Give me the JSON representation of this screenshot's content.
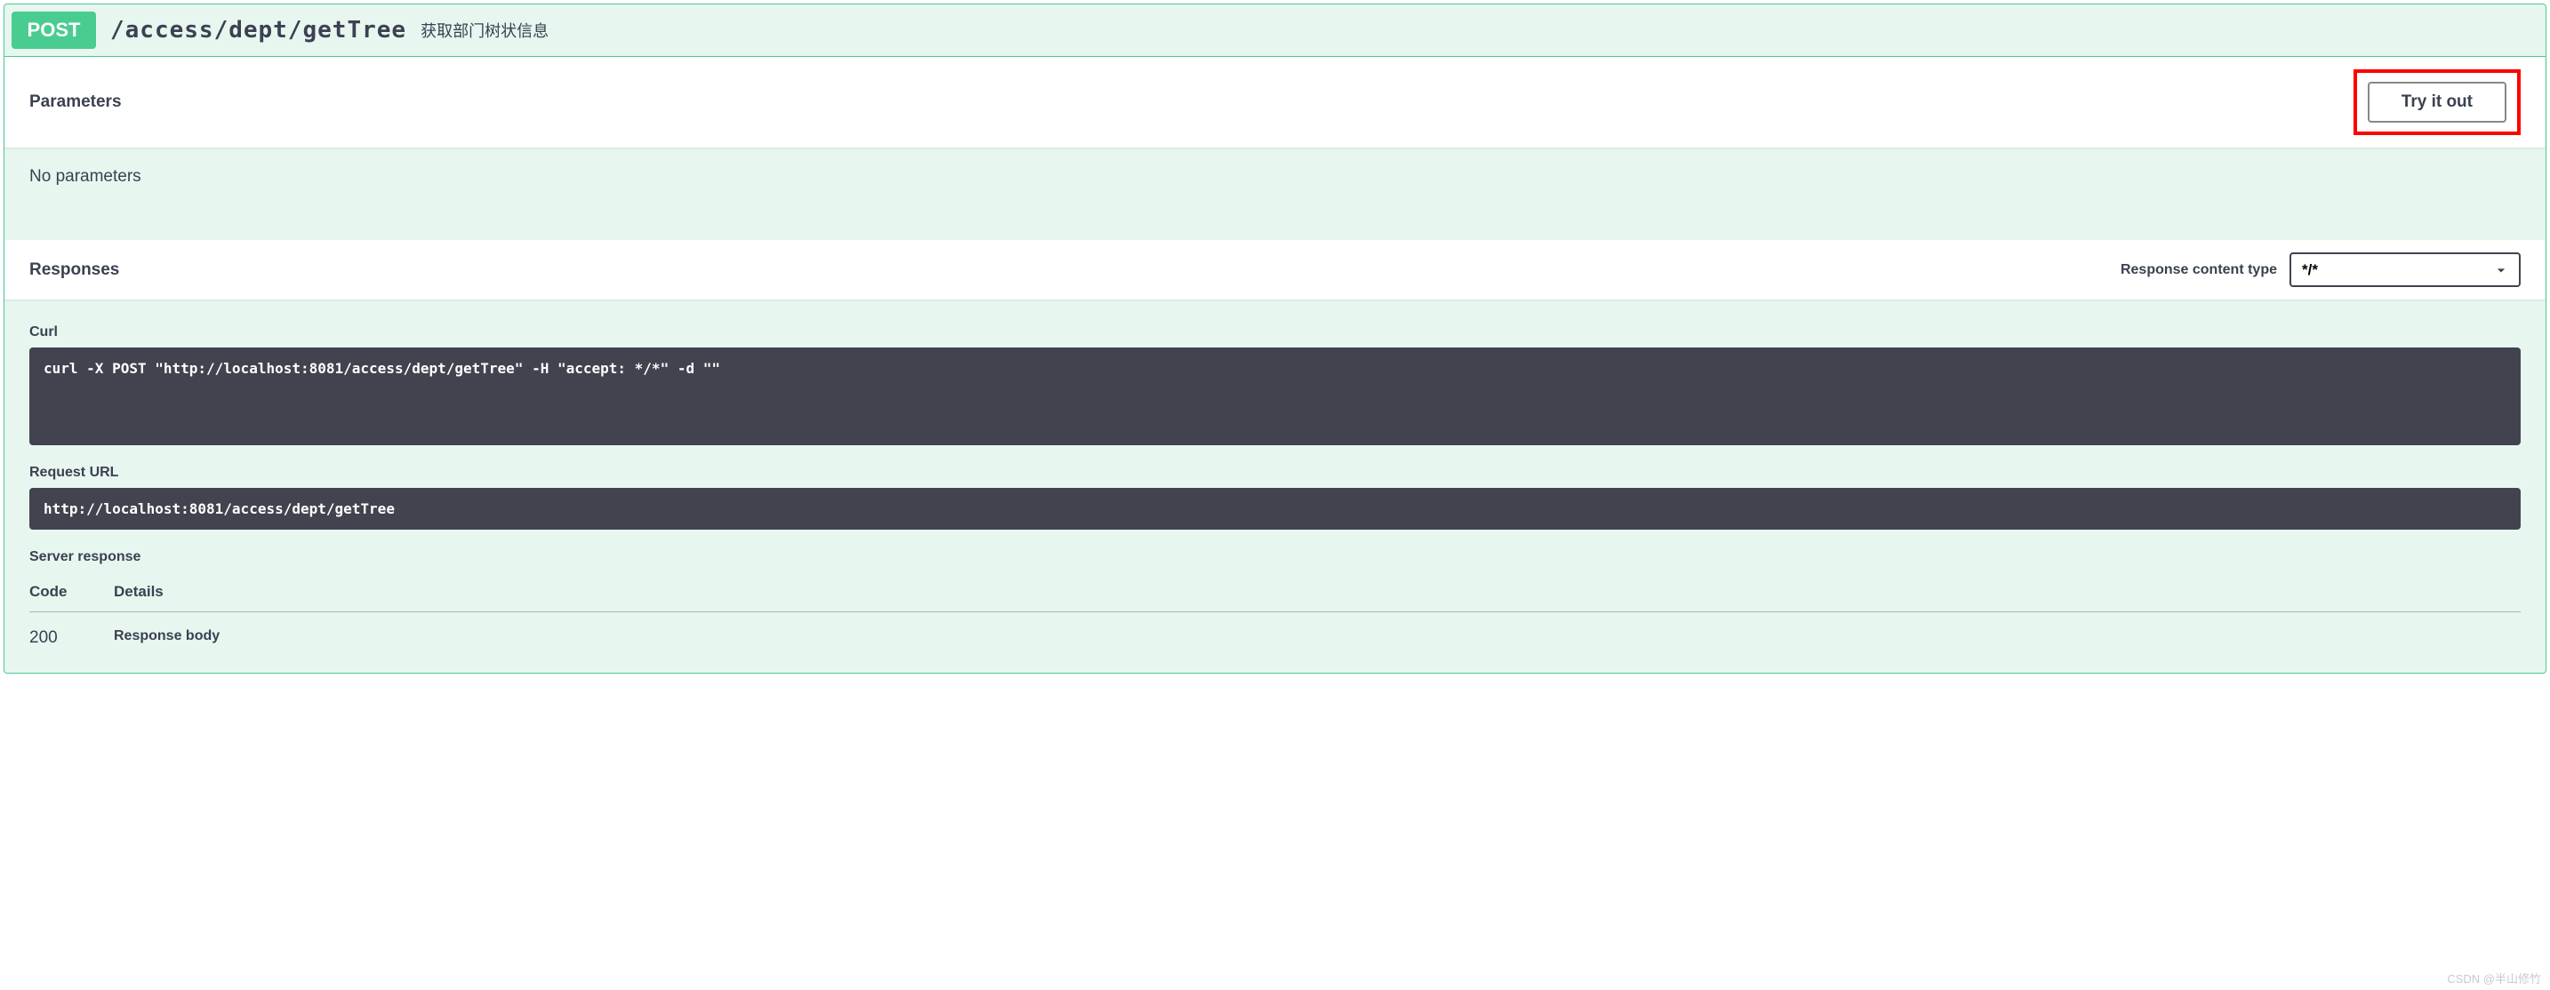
{
  "operation": {
    "method": "POST",
    "path": "/access/dept/getTree",
    "summary": "获取部门树状信息"
  },
  "parameters": {
    "heading": "Parameters",
    "try_out_label": "Try it out",
    "empty_text": "No parameters"
  },
  "responses": {
    "heading": "Responses",
    "content_type_label": "Response content type",
    "content_type_value": "*/*",
    "curl_label": "Curl",
    "curl_command": "curl -X POST \"http://localhost:8081/access/dept/getTree\" -H \"accept: */*\" -d \"\"",
    "request_url_label": "Request URL",
    "request_url_value": "http://localhost:8081/access/dept/getTree",
    "server_response_label": "Server response",
    "table_headers": {
      "code": "Code",
      "details": "Details"
    },
    "rows": [
      {
        "code": "200",
        "body_label": "Response body"
      }
    ]
  },
  "watermark": "CSDN @半山修竹"
}
